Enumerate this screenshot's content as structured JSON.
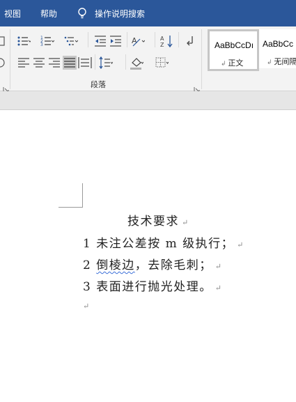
{
  "menu": {
    "view": "视图",
    "help": "帮助",
    "search": "操作说明搜索"
  },
  "ribbon": {
    "paragraph_group": "段落"
  },
  "styles": {
    "normal_sample": "AaBbCcDı",
    "normal_name": "正文",
    "nospacing_sample": "AaBbCc",
    "nospacing_name": "无间隔"
  },
  "document": {
    "title": "技术要求",
    "line1_num": "1",
    "line1_text": "未注公差按 m 级执行；",
    "line2_num": "2",
    "line2_word": "倒棱边",
    "line2_rest": "，去除毛刺；",
    "line3_num": "3",
    "line3_text": "表面进行抛光处理。",
    "paragraph_mark": "↵"
  },
  "colors": {
    "titlebar": "#2b579a",
    "ribbon": "#f3f3f3",
    "squiggle": "#3b6fd8"
  }
}
